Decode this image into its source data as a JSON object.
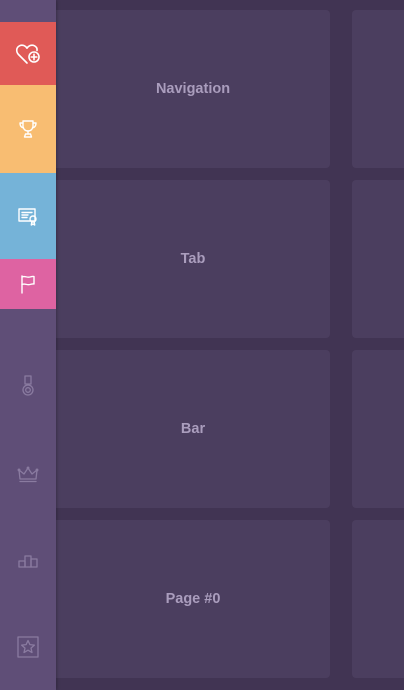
{
  "sidebar": {
    "items": [
      {
        "icon": "heart-plus-icon",
        "color": "#e05a57"
      },
      {
        "icon": "trophy-icon",
        "color": "#f8bd72"
      },
      {
        "icon": "certificate-icon",
        "color": "#75b3d8"
      },
      {
        "icon": "flag-icon",
        "color": "#de63a2"
      },
      {
        "icon": "medal-icon",
        "color": null
      },
      {
        "icon": "crown-icon",
        "color": null
      },
      {
        "icon": "podium-icon",
        "color": null
      },
      {
        "icon": "star-badge-icon",
        "color": null
      }
    ]
  },
  "cards": [
    {
      "label": "Navigation"
    },
    {
      "label": "Tab"
    },
    {
      "label": "Bar"
    },
    {
      "label": "Page #0"
    }
  ]
}
